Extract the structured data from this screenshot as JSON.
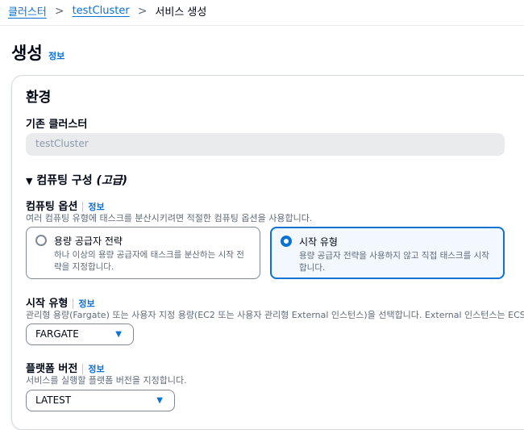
{
  "breadcrumb": [
    {
      "label": "클러스터"
    },
    {
      "label": "testCluster"
    },
    {
      "label": "서비스 생성"
    }
  ],
  "page_title": "생성",
  "info_label": "정보",
  "section": {
    "title": "환경",
    "existing_cluster": {
      "label": "기존 클러스터",
      "value": "testCluster"
    },
    "compute_config": {
      "label": "컴퓨팅 구성",
      "suffix": "(고급)"
    },
    "compute_options": {
      "label": "컴퓨팅 옵션",
      "description": "여러 컴퓨팅 유형에 태스크를 분산시키려면 적절한 컴퓨팅 옵션을 사용합니다.",
      "options": [
        {
          "title": "용량 공급자 전략",
          "description": "하나 이상의 용량 공급자에 태스크를 분산하는 시작 전략을 지정합니다.",
          "selected": false
        },
        {
          "title": "시작 유형",
          "description": "용량 공급자 전략을 사용하지 않고 직접 태스크를 시작합니다.",
          "selected": true
        }
      ]
    },
    "launch_type": {
      "label": "시작 유형",
      "description": "관리형 용량(Fargate) 또는 사용자 지정 용량(EC2 또는 사용자 관리형 External 인스턴스)을 선택합니다. External 인스턴스는 ECS A",
      "value": "FARGATE"
    },
    "platform_version": {
      "label": "플랫폼 버전",
      "description": "서비스를 실행할 플랫폼 버전을 지정합니다.",
      "value": "LATEST"
    }
  }
}
